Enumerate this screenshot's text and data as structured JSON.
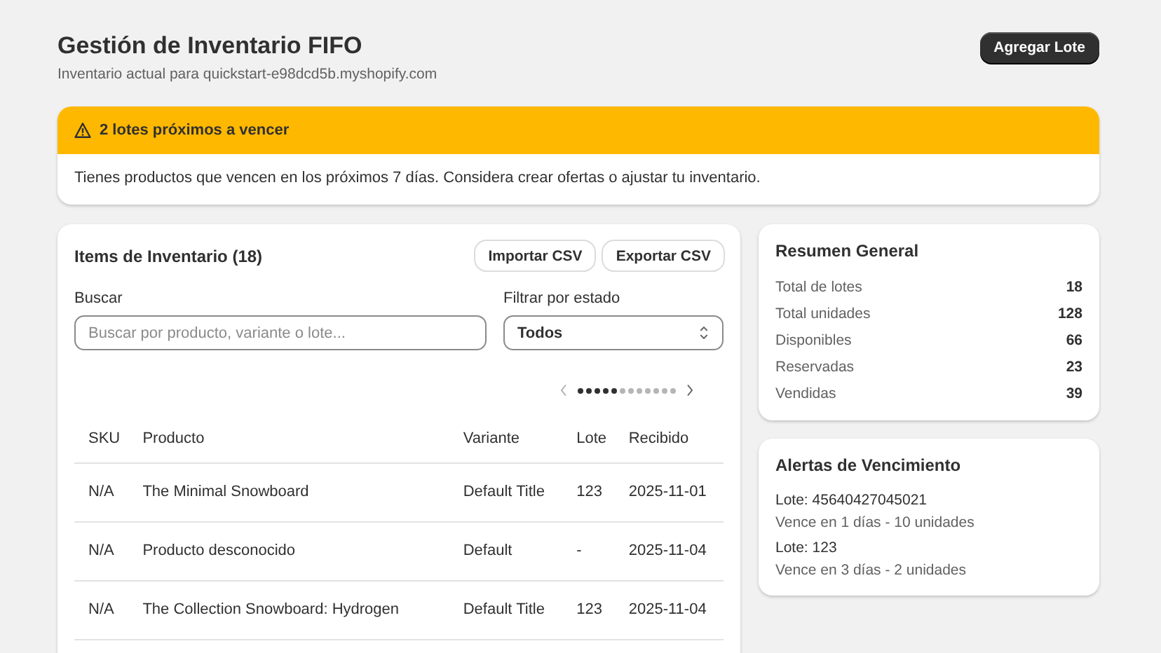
{
  "header": {
    "title": "Gestión de Inventario FIFO",
    "subtitle": "Inventario actual para quickstart-e98dcd5b.myshopify.com",
    "button": "Agregar Lote"
  },
  "banner": {
    "title": "2 lotes próximos a vencer",
    "message": "Tienes productos que vencen en los próximos 7 días. Considera crear ofertas o ajustar tu inventario."
  },
  "inventory": {
    "title": "Items de Inventario (18)",
    "buttons": [
      "Importar CSV",
      "Exportar CSV"
    ],
    "search": {
      "label": "Buscar",
      "placeholder": "Buscar por producto, variante o lote..."
    },
    "filter": {
      "label": "Filtrar por estado",
      "value": "Todos"
    },
    "pagination": [
      {
        "selected": true
      },
      {
        "selected": true
      },
      {
        "selected": true
      },
      {
        "selected": true
      },
      {
        "selected": true
      },
      {
        "selected": false
      },
      {
        "selected": false
      },
      {
        "selected": false
      },
      {
        "selected": false
      },
      {
        "selected": false
      },
      {
        "selected": false
      },
      {
        "selected": false
      }
    ],
    "table": {
      "columns": [
        "SKU",
        "Producto",
        "Variante",
        "Lote",
        "Recibido"
      ],
      "rows": [
        [
          "N/A",
          "The Minimal Snowboard",
          "Default Title",
          "123",
          "2025-11-01"
        ],
        [
          "N/A",
          "Producto desconocido",
          "Default",
          "-",
          "2025-11-04"
        ],
        [
          "N/A",
          "The Collection Snowboard: Hydrogen",
          "Default Title",
          "123",
          "2025-11-04"
        ]
      ]
    }
  },
  "summary": {
    "title": "Resumen General",
    "rows": [
      {
        "label": "Total de lotes",
        "value": "18"
      },
      {
        "label": "Total unidades",
        "value": "128"
      },
      {
        "label": "Disponibles",
        "value": "66"
      },
      {
        "label": "Reservadas",
        "value": "23"
      },
      {
        "label": "Vendidas",
        "value": "39"
      }
    ]
  },
  "alerts": {
    "title": "Alertas de Vencimiento",
    "items": [
      {
        "lot": "Lote: 45640427045021",
        "detail": "Vence en 1 días - 10 unidades"
      },
      {
        "lot": "Lote: 123",
        "detail": "Vence en 3 días - 2 unidades"
      }
    ]
  }
}
